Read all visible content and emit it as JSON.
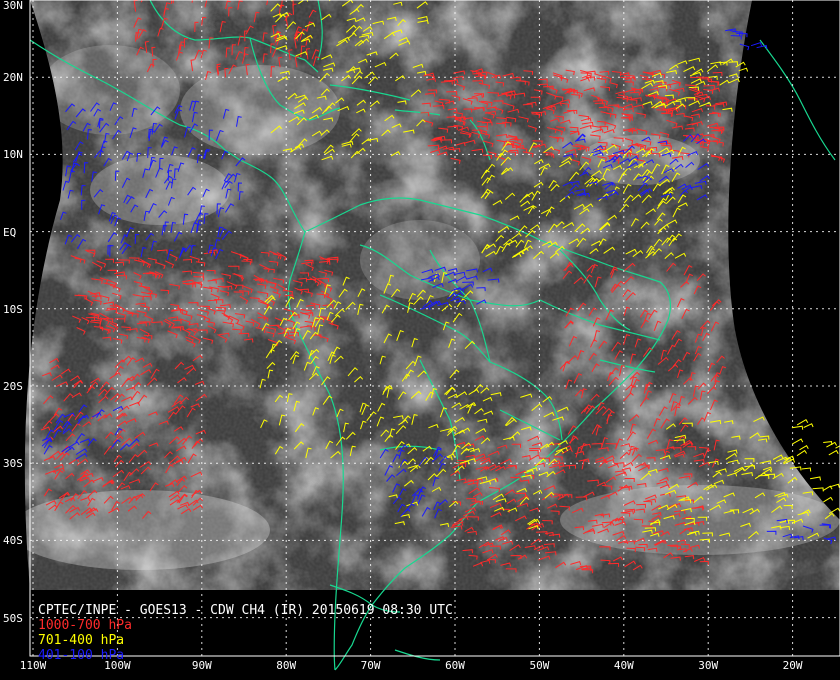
{
  "product": {
    "title": "CPTEC/INPE - GOES13 - CDW CH4 (IR) 20150619 08:30 UTC"
  },
  "legend": [
    {
      "label": "1000-700 hPa",
      "color": "#ff2a2a"
    },
    {
      "label": "701-400 hPa",
      "color": "#ffff00"
    },
    {
      "label": "401-100 hPa",
      "color": "#1a1aff"
    }
  ],
  "colors": {
    "background": "#000000",
    "coastline": "#18d890",
    "grid": "#ffffff",
    "imagery_base": "#3c3c3c"
  },
  "grid": {
    "lat_labels": [
      "30N",
      "20N",
      "10N",
      "EQ",
      "10S",
      "20S",
      "30S",
      "40S",
      "50S"
    ],
    "lon_labels": [
      "110W",
      "100W",
      "90W",
      "80W",
      "70W",
      "60W",
      "50W",
      "40W",
      "30W",
      "20W"
    ]
  }
}
